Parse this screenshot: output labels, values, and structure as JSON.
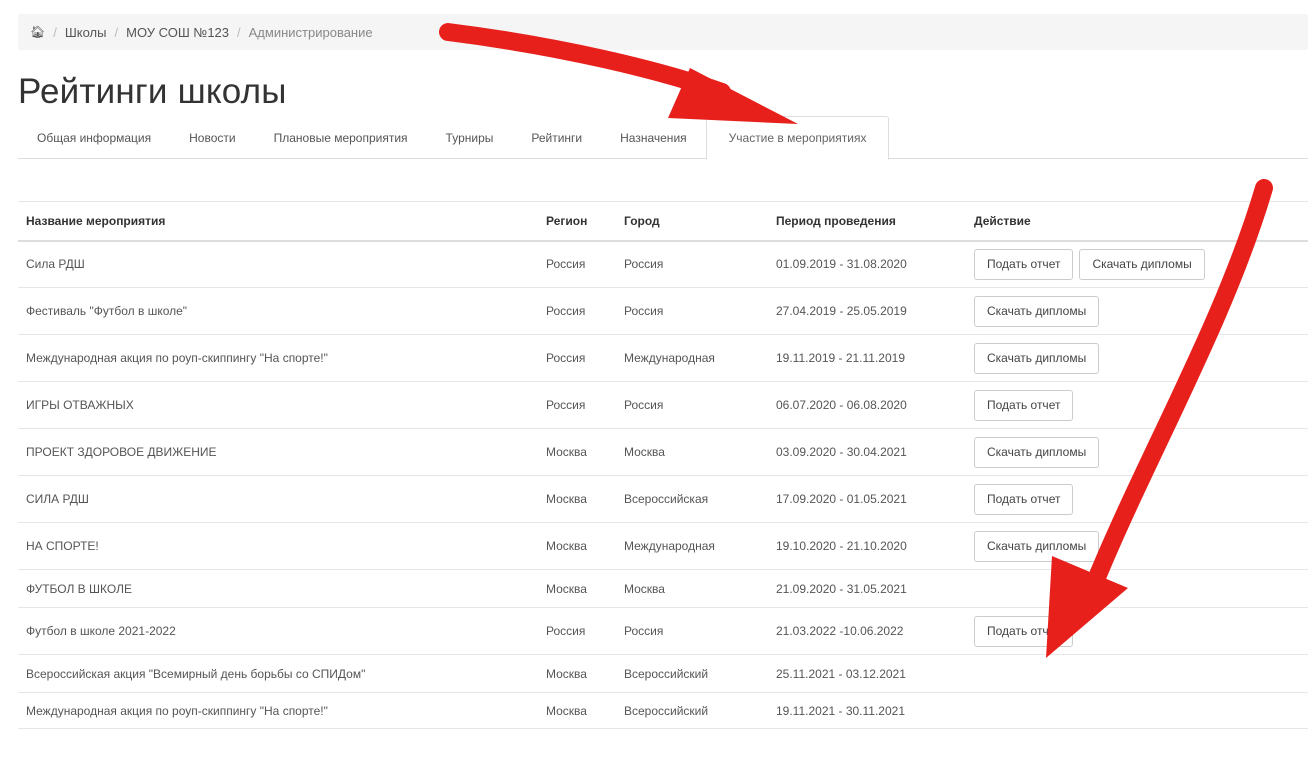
{
  "breadcrumb": {
    "home_icon": "home-icon",
    "items": [
      "Школы",
      "МОУ СОШ №123",
      "Администрирование"
    ]
  },
  "page_title": "Рейтинги школы",
  "tabs": [
    {
      "label": "Общая информация",
      "active": false
    },
    {
      "label": "Новости",
      "active": false
    },
    {
      "label": "Плановые мероприятия",
      "active": false
    },
    {
      "label": "Турниры",
      "active": false
    },
    {
      "label": "Рейтинги",
      "active": false
    },
    {
      "label": "Назначения",
      "active": false
    },
    {
      "label": "Участие в мероприятиях",
      "active": true
    }
  ],
  "table": {
    "headers": {
      "name": "Название мероприятия",
      "region": "Регион",
      "city": "Город",
      "period": "Период проведения",
      "action": "Действие"
    },
    "rows": [
      {
        "name": "Сила РДШ",
        "region": "Россия",
        "city": "Россия",
        "period": "01.09.2019 - 31.08.2020",
        "actions": [
          "Подать отчет",
          "Скачать дипломы"
        ]
      },
      {
        "name": "Фестиваль \"Футбол в школе\"",
        "region": "Россия",
        "city": "Россия",
        "period": "27.04.2019 - 25.05.2019",
        "actions": [
          "Скачать дипломы"
        ]
      },
      {
        "name": "Международная акция по роуп-скиппингу \"На спорте!\"",
        "region": "Россия",
        "city": "Международная",
        "period": "19.11.2019 - 21.11.2019",
        "actions": [
          "Скачать дипломы"
        ]
      },
      {
        "name": "ИГРЫ ОТВАЖНЫХ",
        "region": "Россия",
        "city": "Россия",
        "period": "06.07.2020 - 06.08.2020",
        "actions": [
          "Подать отчет"
        ]
      },
      {
        "name": "ПРОЕКТ ЗДОРОВОЕ ДВИЖЕНИЕ",
        "region": "Москва",
        "city": "Москва",
        "period": "03.09.2020 - 30.04.2021",
        "actions": [
          "Скачать дипломы"
        ]
      },
      {
        "name": "СИЛА РДШ",
        "region": "Москва",
        "city": "Всероссийская",
        "period": "17.09.2020 - 01.05.2021",
        "actions": [
          "Подать отчет"
        ]
      },
      {
        "name": "НА СПОРТЕ!",
        "region": "Москва",
        "city": "Международная",
        "period": "19.10.2020 - 21.10.2020",
        "actions": [
          "Скачать дипломы"
        ]
      },
      {
        "name": "ФУТБОЛ В ШКОЛЕ",
        "region": "Москва",
        "city": "Москва",
        "period": "21.09.2020 - 31.05.2021",
        "actions": []
      },
      {
        "name": "Футбол в школе 2021-2022",
        "region": "Россия",
        "city": "Россия",
        "period": "21.03.2022 -10.06.2022",
        "actions": [
          "Подать отчет"
        ]
      },
      {
        "name": "Всероссийская акция \"Всемирный день борьбы со СПИДом\"",
        "region": "Москва",
        "city": "Всероссийский",
        "period": "25.11.2021 - 03.12.2021",
        "actions": []
      },
      {
        "name": "Международная акция по роуп-скиппингу \"На спорте!\"",
        "region": "Москва",
        "city": "Всероссийский",
        "period": "19.11.2021 - 30.11.2021",
        "actions": []
      }
    ]
  },
  "annotation_color": "#e8201c"
}
